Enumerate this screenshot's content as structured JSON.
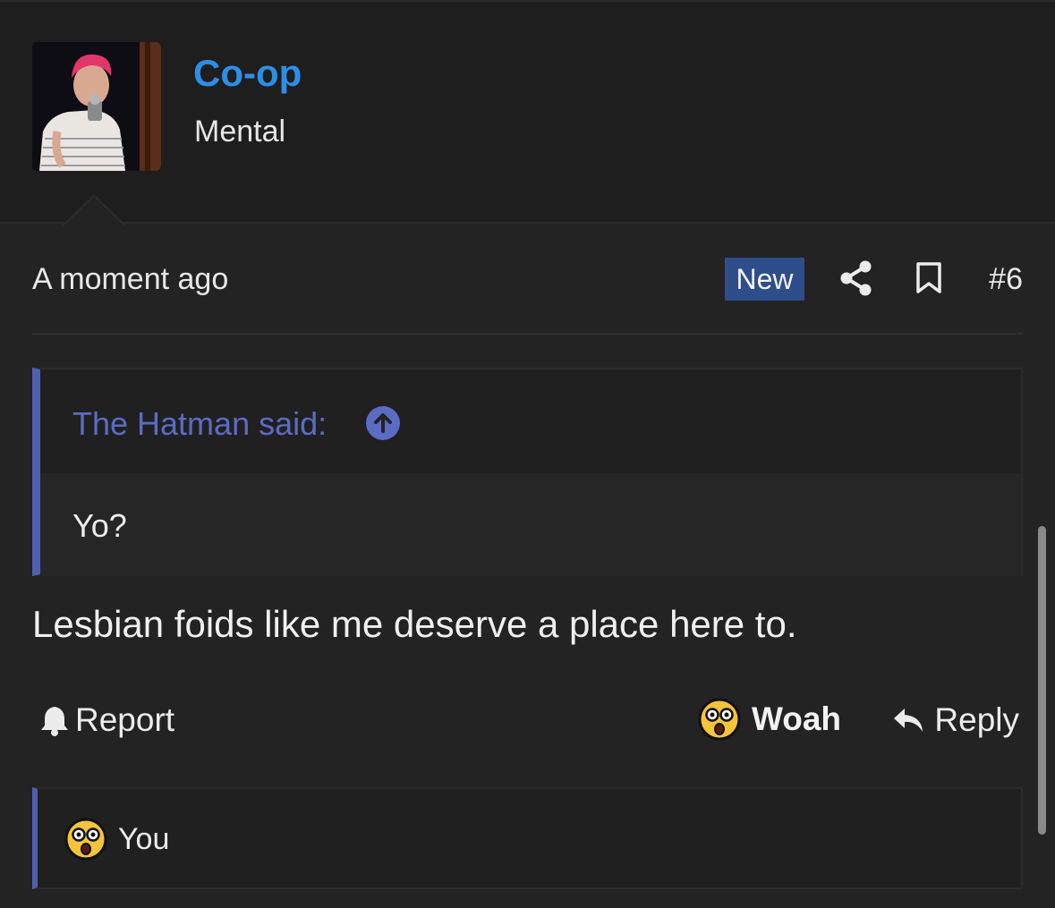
{
  "post": {
    "author": "Co-op",
    "user_title": "Mental",
    "time": "A moment ago",
    "new_badge": "New",
    "post_number": "#6",
    "message": "Lesbian foids like me deserve a place here to."
  },
  "quote": {
    "author_line": "The Hatman said:",
    "text": "Yo?"
  },
  "actions": {
    "report": "Report",
    "reaction": "Woah",
    "reply": "Reply"
  },
  "reactions_bar": {
    "reactors": "You",
    "reaction_icon": "astonished-face-icon"
  },
  "colors": {
    "username": "#2d8ee6",
    "accent": "#4f5fb2",
    "badge": "#2d4e8a",
    "background": "#232323"
  }
}
